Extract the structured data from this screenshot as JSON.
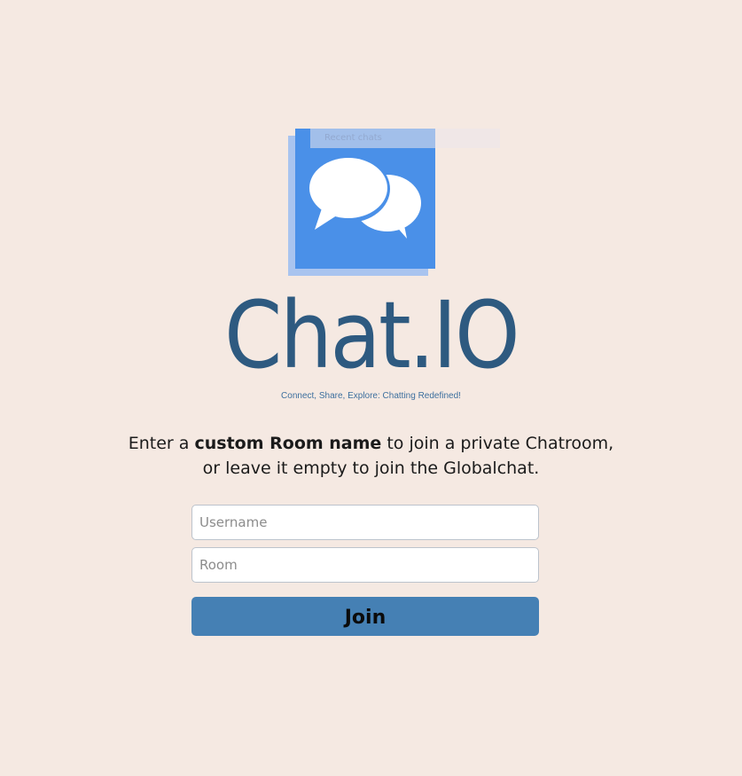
{
  "logo": {
    "icon": "chat-bubbles-icon",
    "colors": {
      "front": "#4a90e8",
      "shadow": "#a9c4ef",
      "bubbles": "#ffffff"
    },
    "faint_label": "Recent chats"
  },
  "brand": {
    "title": "Chat.IO",
    "tagline": "Connect, Share, Explore: Chatting Redefined!",
    "color": "#2e5a80"
  },
  "instructions": {
    "line1_prefix": "Enter a ",
    "line1_bold": "custom Room name",
    "line1_suffix": " to join a private Chatroom,",
    "line2": "or leave it empty to join the Globalchat."
  },
  "form": {
    "username": {
      "placeholder": "Username",
      "value": ""
    },
    "room": {
      "placeholder": "Room",
      "value": ""
    },
    "join_label": "Join",
    "join_color": "#4580b4"
  },
  "background": "#f5e9e2"
}
